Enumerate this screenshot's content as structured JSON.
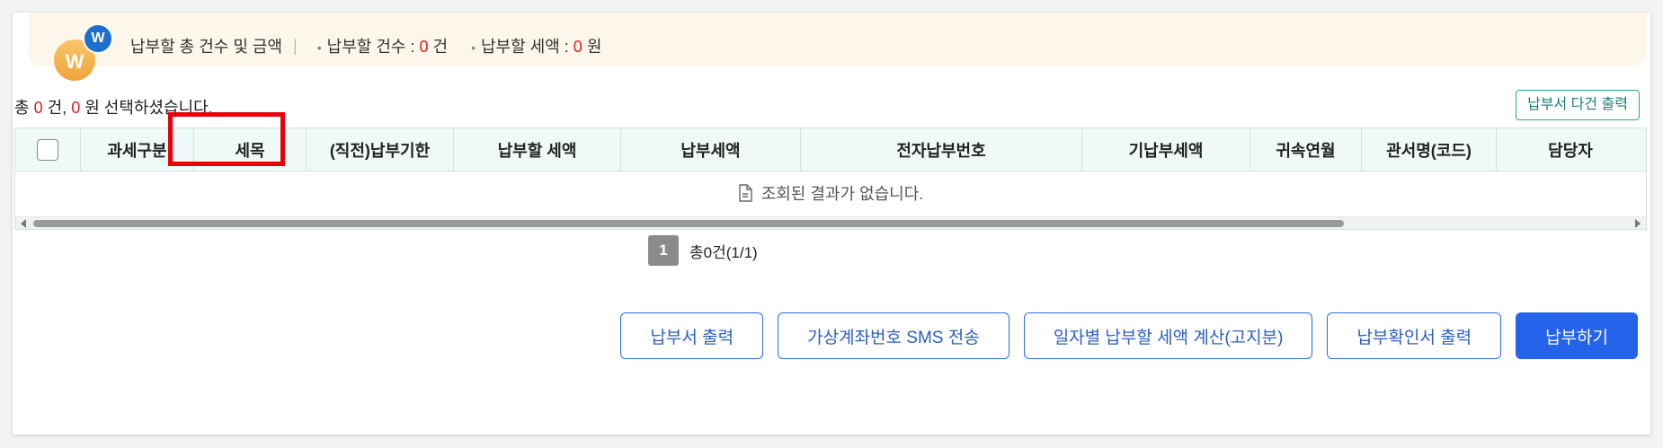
{
  "summary": {
    "title": "납부할 총 건수 및 금액",
    "separator": "|",
    "count_label": "납부할 건수 :",
    "count_value": "0",
    "count_unit": "건",
    "amount_label": "납부할 세액 :",
    "amount_value": "0",
    "amount_unit": "원",
    "logo_big": "W",
    "logo_small": "W"
  },
  "selection": {
    "prefix": "총",
    "count": "0",
    "mid": "건,",
    "amount": "0",
    "suffix": "원 선택하셨습니다."
  },
  "multi_print_button": "납부서 다건 출력",
  "table": {
    "columns": [
      "과세구분",
      "세목",
      "(직전)납부기한",
      "납부할 세액",
      "납부세액",
      "전자납부번호",
      "기납부세액",
      "귀속연월",
      "관서명(코드)",
      "담당자"
    ],
    "empty_message": "조회된 결과가 없습니다."
  },
  "pagination": {
    "current_page": "1",
    "total_text": "총0건(1/1)"
  },
  "actions": {
    "print_bill": "납부서 출력",
    "sms_virtual_account": "가상계좌번호 SMS 전송",
    "daily_tax_calc": "일자별 납부할 세액 계산(고지분)",
    "print_confirmation": "납부확인서 출력",
    "pay": "납부하기"
  },
  "colors": {
    "highlight": "#e8000b",
    "primary": "#2563eb",
    "header_bg": "#eff9f8",
    "summary_bg": "#fdf6ea"
  }
}
